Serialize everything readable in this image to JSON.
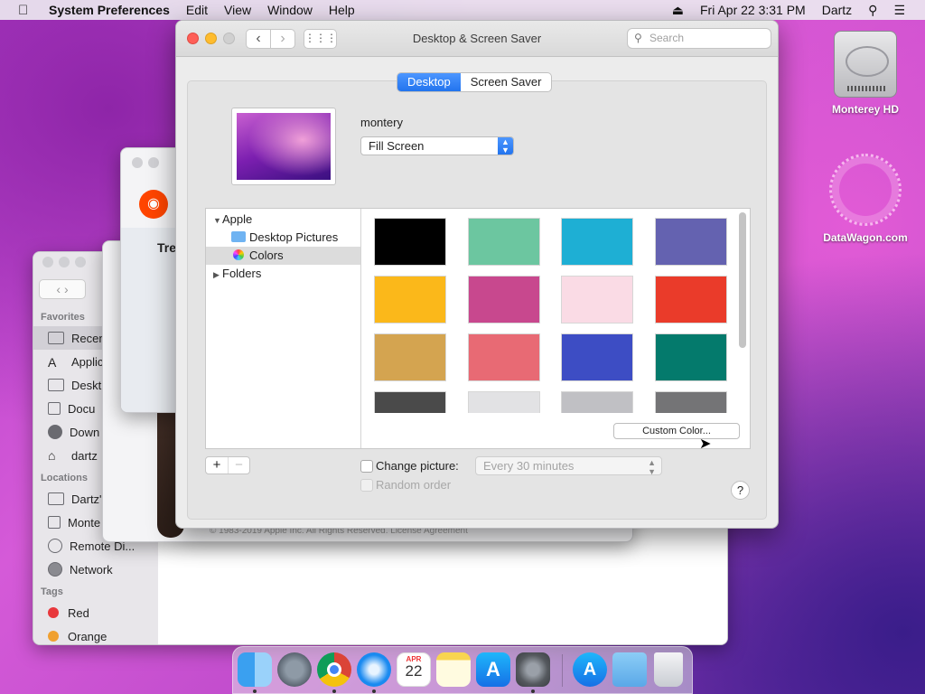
{
  "menubar": {
    "items": [
      "System Preferences",
      "Edit",
      "View",
      "Window",
      "Help"
    ],
    "clock": "Fri Apr 22  3:31 PM",
    "user": "Dartz"
  },
  "desktop_icons": [
    {
      "label": "Monterey HD"
    },
    {
      "label": "DataWagon.com"
    }
  ],
  "finder": {
    "favorites_title": "Favorites",
    "favorites": [
      "Recen",
      "Applic",
      "Deskt",
      "Docu",
      "Down",
      "dartz"
    ],
    "locations_title": "Locations",
    "locations": [
      "Dartz'",
      "Monte",
      "Remote Di...",
      "Network"
    ],
    "tags_title": "Tags",
    "tags": [
      {
        "label": "Red",
        "color": "#e8383d"
      },
      {
        "label": "Orange",
        "color": "#f0a030"
      }
    ]
  },
  "background_text": {
    "fragment_tre": "Tre",
    "footer": "© 1983-2019 Apple Inc. All Rights Reserved. License Agreement"
  },
  "window": {
    "title": "Desktop & Screen Saver",
    "search_placeholder": "Search",
    "tabs": [
      {
        "label": "Desktop",
        "active": true
      },
      {
        "label": "Screen Saver",
        "active": false
      }
    ],
    "picture_name": "montery",
    "fill_mode": "Fill Screen",
    "source_list": {
      "apple": "Apple",
      "desktop_pictures": "Desktop Pictures",
      "colors": "Colors",
      "folders": "Folders"
    },
    "swatches": [
      "#000000",
      "#6cc6a0",
      "#1eafd4",
      "#6462b0",
      "#fbb81a",
      "#c8488e",
      "#fadbe5",
      "#ea3b2a",
      "#d4a450",
      "#e86a74",
      "#3d4dc4",
      "#047a6c",
      "#4a4a4a",
      "#e2e2e4",
      "#c0c0c4",
      "#747476"
    ],
    "custom_color_label": "Custom Color...",
    "add_label": "+",
    "remove_label": "−",
    "change_picture_label": "Change picture:",
    "interval": "Every 30 minutes",
    "random_order_label": "Random order",
    "help_label": "?"
  },
  "dock": {
    "apps": [
      "finder-icon",
      "launchpad-icon",
      "chrome-icon",
      "safari-icon",
      "calendar-icon",
      "notes-icon",
      "app-store-icon",
      "system-preferences-icon",
      "app-store-folder-icon",
      "downloads-folder-icon",
      "trash-icon"
    ],
    "calendar_month": "APR",
    "calendar_day": "22"
  }
}
